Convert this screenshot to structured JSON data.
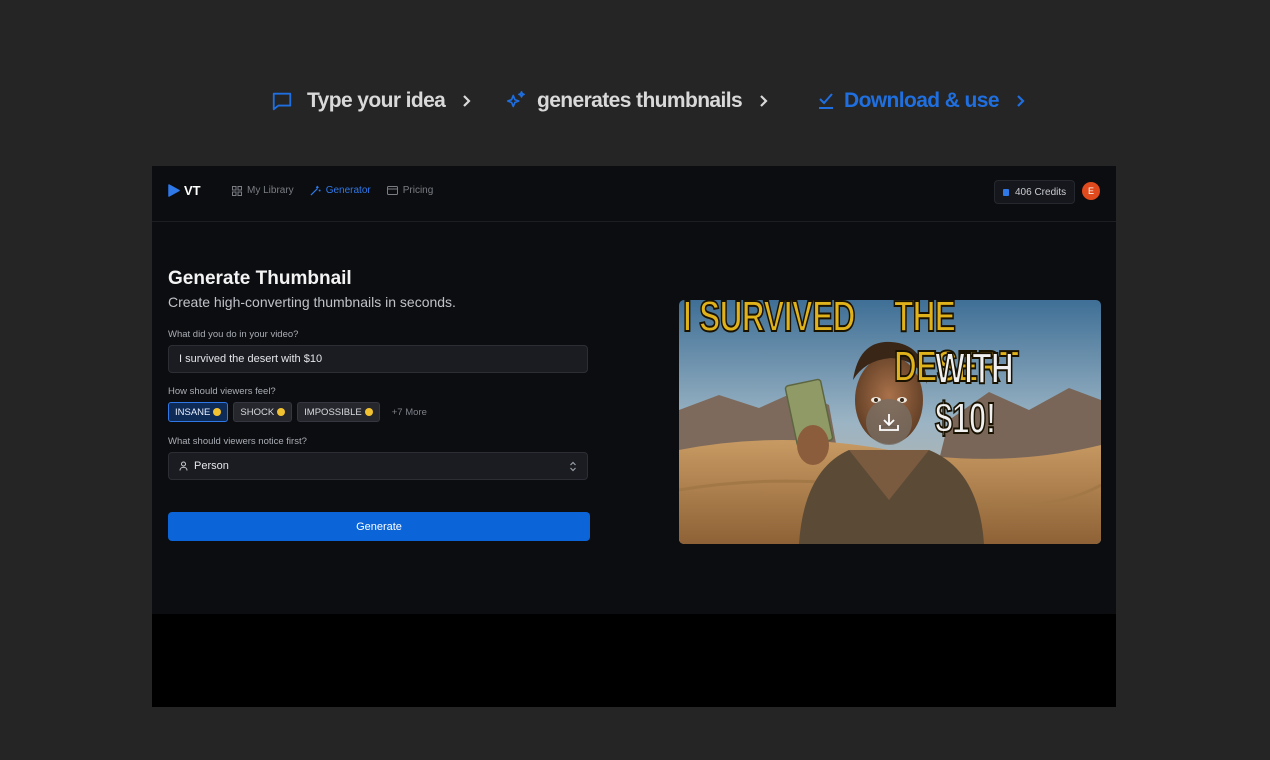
{
  "steps": [
    {
      "label": "Type your idea",
      "icon": "chat-bubble-icon",
      "active": false
    },
    {
      "label": "generates thumbnails",
      "icon": "sparkles-icon",
      "active": false
    },
    {
      "label": "Download & use",
      "icon": "check-icon",
      "active": true
    }
  ],
  "colors": {
    "accent": "#1f6fe0",
    "page_bg": "#252525",
    "app_bg": "#0c0d10",
    "button": "#0b64d8",
    "thumb_text": "#e0b21c",
    "thumb_text_2": "#f1f1f1"
  },
  "nav": {
    "logo": "VT",
    "links": [
      {
        "label": "My Library",
        "icon": "grid-icon"
      },
      {
        "label": "Generator",
        "icon": "wand-icon",
        "active": true
      },
      {
        "label": "Pricing",
        "icon": "card-icon"
      }
    ],
    "credits": "406 Credits",
    "avatar": "E"
  },
  "form": {
    "title": "Generate Thumbnail",
    "subtitle": "Create high-converting thumbnails in seconds.",
    "q1_label": "What did you do in your video?",
    "q1_value": "I survived the desert with $10",
    "q2_label": "How should viewers feel?",
    "chips": [
      {
        "label": "INSANE",
        "selected": true
      },
      {
        "label": "SHOCK",
        "selected": false
      },
      {
        "label": "IMPOSSIBLE",
        "selected": false
      }
    ],
    "more": "+7 More",
    "q3_label": "What should viewers notice first?",
    "q3_value": "Person",
    "generate": "Generate"
  },
  "thumbnail": {
    "line1a": "I SURVIVED",
    "line1b": "THE DESERT",
    "line2": "WITH $10!"
  }
}
